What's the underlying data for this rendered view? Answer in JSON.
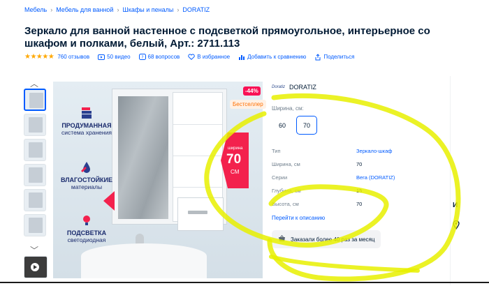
{
  "breadcrumbs": [
    "Мебель",
    "Мебель для ванной",
    "Шкафы и пеналы",
    "DORATIZ"
  ],
  "product": {
    "title": "Зеркало для ванной настенное с подсветкой прямоугольное, интерьерное со шкафом и полками, белый, Арт.: 2711.113"
  },
  "meta": {
    "rating_stars": "★★★★★",
    "reviews": "760 отзывов",
    "videos": "50 видео",
    "questions": "68 вопросов",
    "favorite": "В избранное",
    "compare": "Добавить к сравнению",
    "share": "Поделиться"
  },
  "icons": {
    "up": "chevron-up-icon",
    "down": "chevron-down-icon",
    "video": "video-icon",
    "question": "question-icon",
    "heart": "heart-icon",
    "compare": "compare-icon",
    "share": "share-icon",
    "cart": "basket-icon",
    "pin": "location-pin-icon"
  },
  "image": {
    "features": [
      {
        "title": "ПРОДУМАННАЯ",
        "subtitle": "система хранения"
      },
      {
        "title": "ВЛАГОСТОЙКИЕ",
        "subtitle": "материалы"
      },
      {
        "title": "ПОДСВЕТКА",
        "subtitle": "светодиодная"
      }
    ],
    "sale_badge": "-44%",
    "bestseller_badge": "Бестселлер",
    "width_banner_label": "ширина",
    "width_banner_value": "70",
    "width_banner_unit": "СМ"
  },
  "brand": {
    "logo_text": "Doratiz",
    "name": "DORATIZ"
  },
  "width_selector": {
    "label": "Ширина, см:",
    "options": [
      "60",
      "70"
    ],
    "selected": "70"
  },
  "specs": [
    {
      "key": "Тип",
      "value": "Зеркало-шкаф",
      "link": true
    },
    {
      "key": "Ширина, см",
      "value": "70",
      "link": false
    },
    {
      "key": "Серии",
      "value": "Вега (DORATIZ)",
      "link": true
    },
    {
      "key": "Глубина, см",
      "value": "15",
      "link": false
    },
    {
      "key": "Высота, см",
      "value": "70",
      "link": false
    }
  ],
  "description_link": "Перейти к описанию",
  "ordered": "Заказали более 40 раз за месяц",
  "side_text": "И",
  "colors": {
    "accent": "#005bff",
    "sale": "#f91155",
    "star": "#ffa800",
    "highlight": "#e8f000"
  }
}
